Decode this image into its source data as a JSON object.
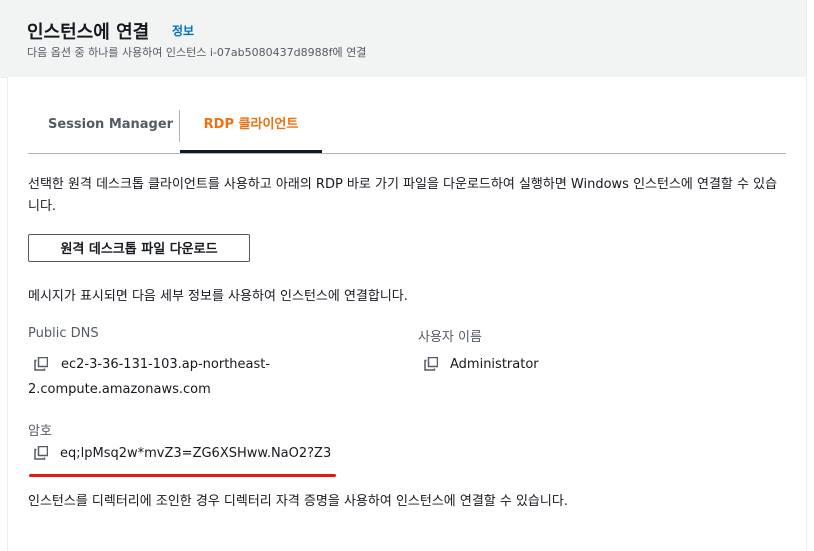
{
  "header": {
    "title": "인스턴스에 연결",
    "info_link": "정보",
    "subtitle": "다음 옵션 중 하나를 사용하여 인스턴스 i-07ab5080437d8988f에 연결"
  },
  "tabs": [
    {
      "label": "Session Manager",
      "active": false
    },
    {
      "label": "RDP 클라이언트",
      "active": true
    }
  ],
  "rdp": {
    "description": "선택한 원격 데스크톱 클라이언트를 사용하고 아래의 RDP 바로 가기 파일을 다운로드하여 실행하면 Windows 인스턴스에 연결할 수 있습니다.",
    "download_button": "원격 데스크톱 파일 다운로드",
    "message": "메시지가 표시되면 다음 세부 정보를 사용하여 인스턴스에 연결합니다.",
    "public_dns_label": "Public DNS",
    "public_dns_line1": "ec2-3-36-131-103.ap-northeast-",
    "public_dns_line2": "2.compute.amazonaws.com",
    "username_label": "사용자 이름",
    "username_value": "Administrator",
    "password_label": "암호",
    "password_value": "eq;lpMsq2w*mvZ3=ZG6XSHww.NaO2?Z3",
    "footer_note": "인스턴스를 디렉터리에 조인한 경우 디렉터리 자격 증명을 사용하여 인스턴스에 연결할 수 있습니다."
  },
  "colors": {
    "accent": "#ec7211",
    "link": "#0073bb",
    "annotation": "#e01818"
  },
  "icons": {
    "copy": "copy-icon"
  }
}
